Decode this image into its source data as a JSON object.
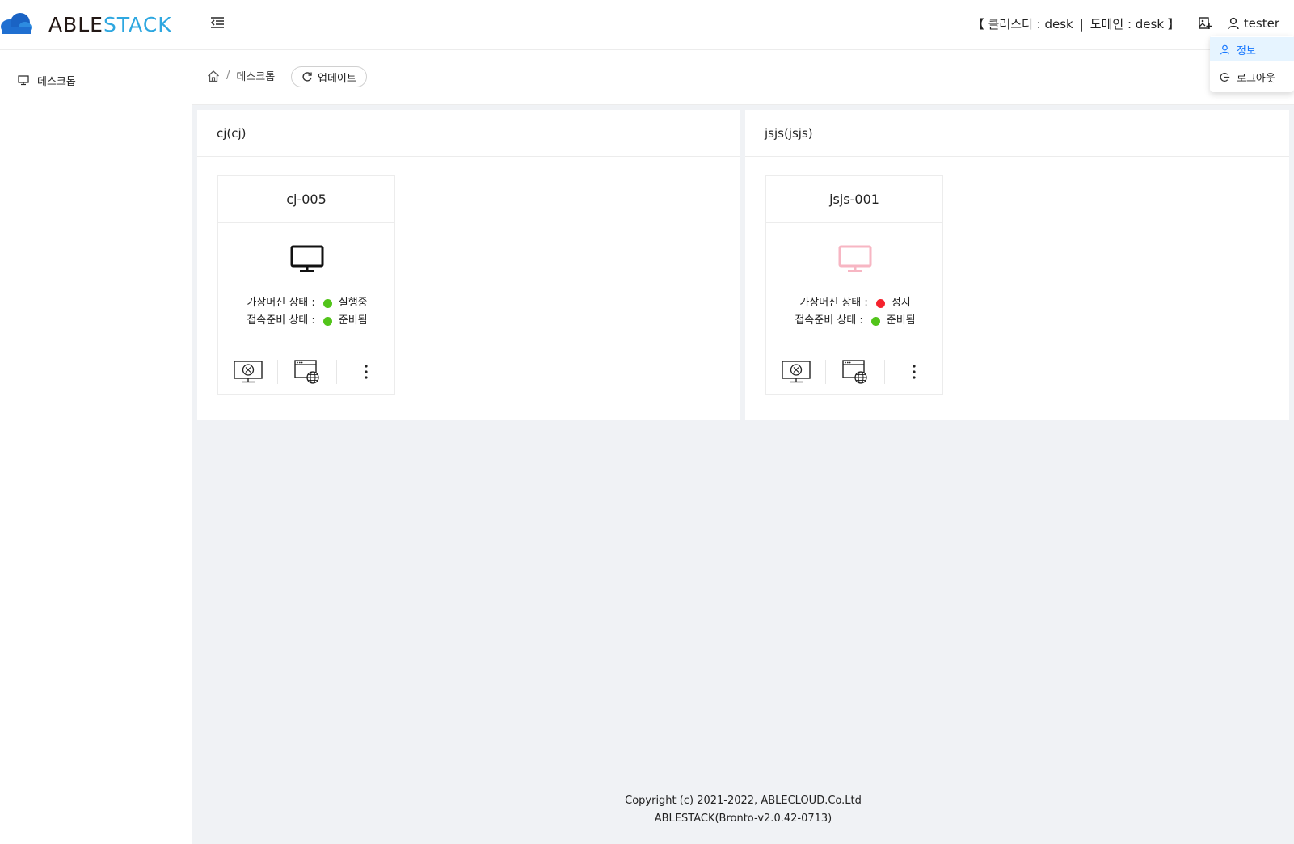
{
  "brand": {
    "name_part1": "ABLE",
    "name_part2": "STACK"
  },
  "sidebar": {
    "items": [
      {
        "label": "데스크톱",
        "icon": "desktop-icon"
      }
    ]
  },
  "header": {
    "context": {
      "open": "【 클러스터 : desk",
      "separator": "|",
      "domain": "도메인 : desk 】"
    },
    "user": "tester"
  },
  "user_menu": {
    "items": [
      {
        "label": "정보",
        "icon": "user-icon"
      },
      {
        "label": "로그아웃",
        "icon": "logout-icon"
      }
    ]
  },
  "breadcrumb": {
    "separator": "/",
    "current": "데스크톱"
  },
  "update_button": "업데이트",
  "groups": [
    {
      "title": "cj(cj)",
      "vms": [
        {
          "name": "cj-005",
          "monitor_color": "#111111",
          "vm_state_label": "가상머신 상태 :",
          "vm_state": "실행중",
          "vm_state_color": "#52c41a",
          "conn_state_label": "접속준비 상태 :",
          "conn_state": "준비됨",
          "conn_state_color": "#52c41a"
        }
      ]
    },
    {
      "title": "jsjs(jsjs)",
      "vms": [
        {
          "name": "jsjs-001",
          "monitor_color": "#f7b6c3",
          "vm_state_label": "가상머신 상태 :",
          "vm_state": "정지",
          "vm_state_color": "#f5222d",
          "conn_state_label": "접속준비 상태 :",
          "conn_state": "준비됨",
          "conn_state_color": "#52c41a"
        }
      ]
    }
  ],
  "footer": {
    "line1": "Copyright (c) 2021-2022, ABLECLOUD.Co.Ltd",
    "line2": "ABLESTACK(Bronto-v2.0.42-0713)"
  }
}
